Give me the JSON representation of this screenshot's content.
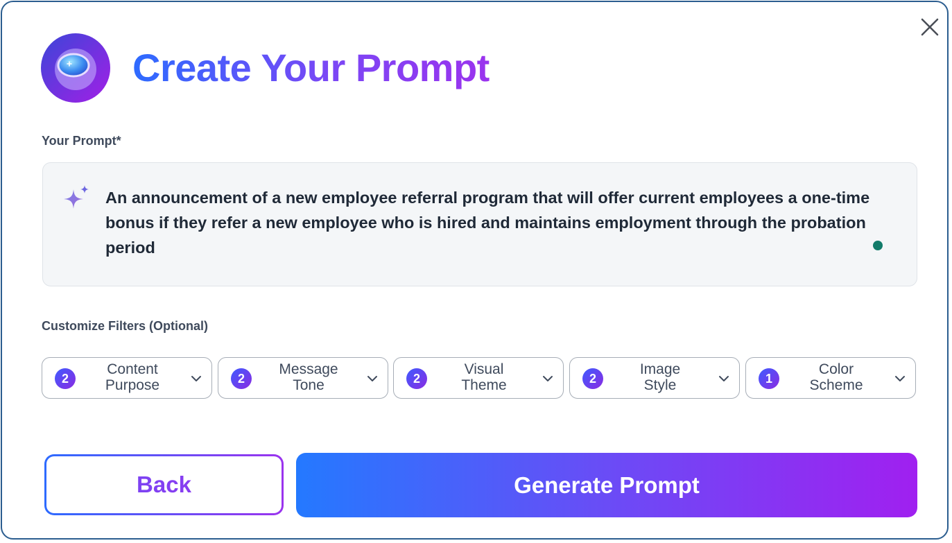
{
  "dialog": {
    "title": "Create Your Prompt",
    "close_icon": "close-icon",
    "logo_icon": "app-logo-icon",
    "accent_colors": {
      "start": "#2d6bff",
      "end": "#9b33ee"
    }
  },
  "prompt": {
    "label": "Your Prompt*",
    "icon": "sparkle-icon",
    "value": "An announcement of a new employee referral program that will offer current employees a one-time bonus if they refer a new employee who is hired and maintains employment through the probation period",
    "status_color": "#127b6a"
  },
  "filters": {
    "label": "Customize Filters (Optional)",
    "items": [
      {
        "count": "2",
        "line1": "Content",
        "line2": "Purpose"
      },
      {
        "count": "2",
        "line1": "Message",
        "line2": "Tone"
      },
      {
        "count": "2",
        "line1": "Visual",
        "line2": "Theme"
      },
      {
        "count": "2",
        "line1": "Image",
        "line2": "Style"
      },
      {
        "count": "1",
        "line1": "Color",
        "line2": "Scheme"
      }
    ]
  },
  "actions": {
    "back_label": "Back",
    "generate_label": "Generate Prompt"
  }
}
